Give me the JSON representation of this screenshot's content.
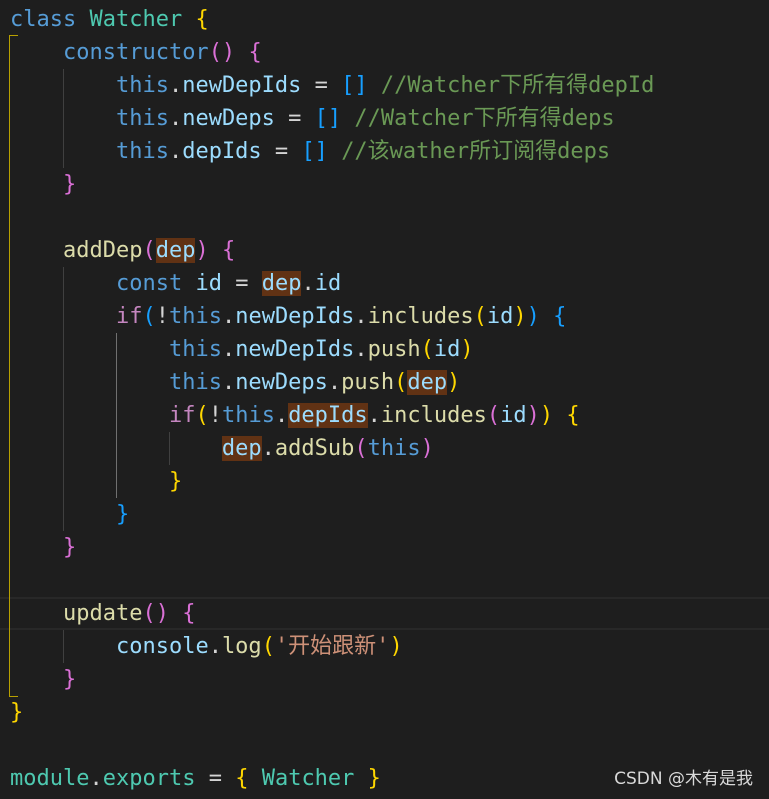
{
  "code": {
    "kw_class": "class",
    "class_name": "Watcher",
    "kw_constructor": "constructor",
    "kw_this": "this",
    "prop_newDepIds": "newDepIds",
    "prop_newDeps": "newDeps",
    "prop_depIds": "depIds",
    "comment_1": "//Watcher下所有得depId",
    "comment_2": "//Watcher下所有得deps",
    "comment_3": "//该wather所订阅得deps",
    "fn_addDep": "addDep",
    "param_dep": "dep",
    "kw_const": "const",
    "var_id": "id",
    "kw_if": "if",
    "fn_includes": "includes",
    "fn_push": "push",
    "fn_addSub": "addSub",
    "fn_update": "update",
    "obj_console": "console",
    "fn_log": "log",
    "str_log": "'开始跟新'",
    "obj_module": "module",
    "prop_exports": "exports"
  },
  "watermark": "CSDN @木有是我"
}
